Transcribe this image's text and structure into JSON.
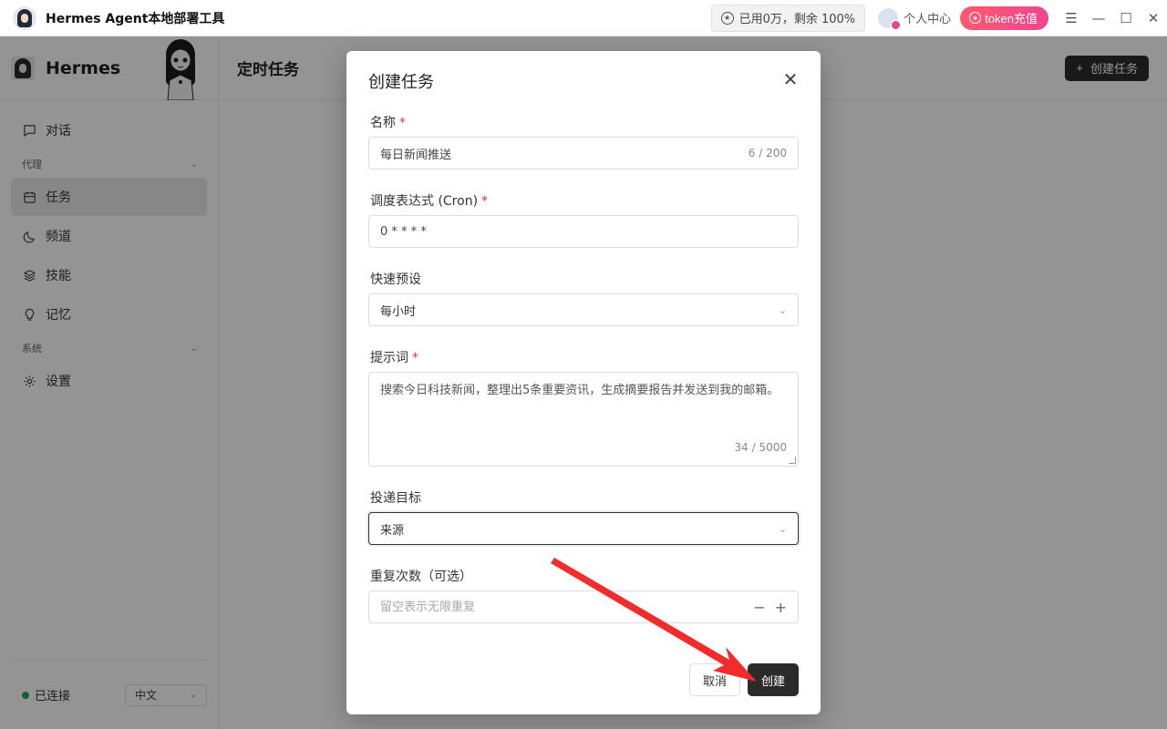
{
  "app": {
    "title": "Hermes Agent本地部署工具",
    "usage_text": "已用0万，剩余 100%",
    "user_center": "个人中心",
    "token_button": "token充值"
  },
  "sidebar": {
    "brand": "Hermes",
    "items": [
      {
        "label": "对话",
        "icon": "chat-icon"
      },
      {
        "label": "任务",
        "icon": "calendar-icon",
        "active": true
      },
      {
        "label": "频道",
        "icon": "moon-icon"
      },
      {
        "label": "技能",
        "icon": "layers-icon"
      },
      {
        "label": "记忆",
        "icon": "bulb-icon"
      },
      {
        "label": "设置",
        "icon": "gear-icon"
      }
    ],
    "group_agent": "代理",
    "group_system": "系统",
    "status": "已连接",
    "language": "中文"
  },
  "main": {
    "title": "定时任务",
    "create_button": "创建任务"
  },
  "dialog": {
    "title": "创建任务",
    "name": {
      "label": "名称",
      "value": "每日新闻推送",
      "counter": "6 / 200"
    },
    "cron": {
      "label": "调度表达式 (Cron)",
      "value": "0 * * * *"
    },
    "preset": {
      "label": "快速预设",
      "value": "每小时"
    },
    "prompt": {
      "label": "提示词",
      "value": "搜索今日科技新闻，整理出5条重要资讯，生成摘要报告并发送到我的邮箱。",
      "counter": "34 / 5000"
    },
    "target": {
      "label": "投递目标",
      "value": "来源"
    },
    "repeat": {
      "label": "重复次数（可选）",
      "placeholder": "留空表示无限重复"
    },
    "cancel": "取消",
    "create": "创建"
  },
  "colors": {
    "accent": "#2b2b2b",
    "token_gradient_start": "#ff5a6e",
    "token_gradient_end": "#f0458e",
    "required": "#e0364a",
    "connected": "#22a55a",
    "annotation_arrow": "#f22b2b"
  }
}
